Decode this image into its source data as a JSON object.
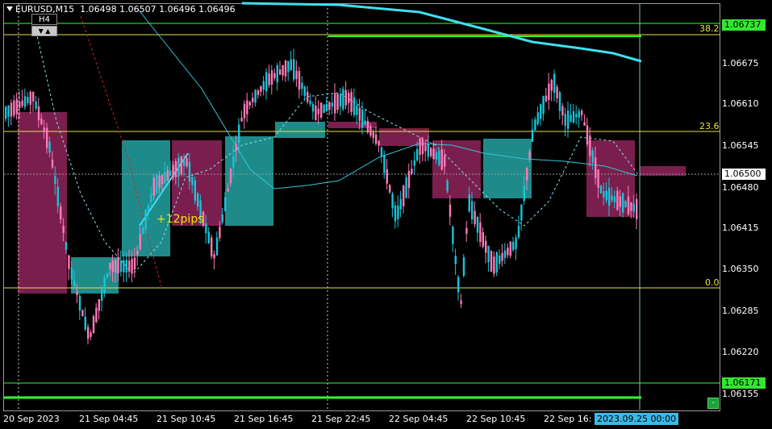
{
  "chart": {
    "symbol_label": "EURUSD,M15",
    "ohlc_label": "1.06498 1.06507 1.06496 1.06496",
    "timeframe_badge": "H4",
    "timeframe_buttons": "▼ ▲",
    "pips_annotation": "+12pips",
    "corner_button": "-"
  },
  "price_axis": {
    "labels": [
      "1.06675",
      "1.06610",
      "1.06545",
      "1.06480",
      "1.06415",
      "1.06350",
      "1.06285",
      "1.06220",
      "1.06155"
    ],
    "tag_top": "1.06737",
    "tag_current": "1.06500",
    "tag_bottom": "1.06171",
    "colors": {
      "top": "#33e633",
      "current": "#ffffff",
      "bottom": "#33e633"
    }
  },
  "fibo_levels": [
    "38.2",
    "23.6",
    "0.0"
  ],
  "time_axis": {
    "labels": [
      "20 Sep 2023",
      "21 Sep 04:45",
      "21 Sep 10:45",
      "21 Sep 16:45",
      "21 Sep 22:45",
      "22 Sep 04:45",
      "22 Sep 10:45",
      "22 Sep 16:"
    ],
    "highlighted": "2023.09.25 00:00"
  },
  "colors": {
    "background": "#000000",
    "bull": "#19c4d6",
    "bear": "#ff7ab8",
    "htf_bull": "#1f8a8a",
    "htf_bear": "#7a1f4d",
    "ma_thick": "#3fe0f0",
    "fibo": "#e6e04a",
    "green_line": "#33ff33"
  }
}
